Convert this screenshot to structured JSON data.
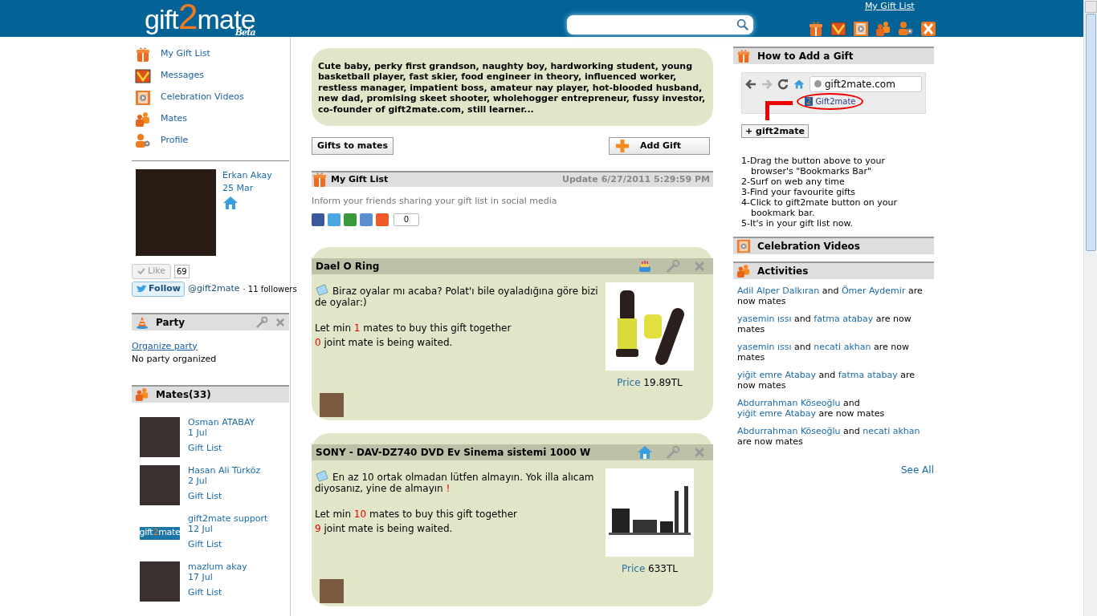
{
  "header": {
    "logo": {
      "before": "gift",
      "mark": "2",
      "after": "mate",
      "badge": "Beta"
    },
    "top_link": "My Gift List"
  },
  "nav": [
    {
      "label": "My Gift List"
    },
    {
      "label": "Messages"
    },
    {
      "label": "Celebration Videos"
    },
    {
      "label": "Mates"
    },
    {
      "label": "Profile"
    }
  ],
  "profile": {
    "name": "Erkan Akay",
    "date": "25 Mar"
  },
  "like": {
    "label": "Like",
    "count": "69"
  },
  "follow": {
    "label": "Follow",
    "handle": "@gift2mate",
    "followers": "· 11 followers"
  },
  "party": {
    "title": "Party",
    "link": "Organize party",
    "status": "No party organized"
  },
  "mates": {
    "title": "Mates(33)",
    "items": [
      {
        "name": "Osman ATABAY",
        "date": "1 Jul",
        "link": "Gift List",
        "kind": "photo"
      },
      {
        "name": "Hasan Ali Türköz",
        "date": "2 Jul",
        "link": "Gift List",
        "kind": "photo"
      },
      {
        "name": "gift2mate support",
        "date": "12 Jul",
        "link": "Gift List",
        "kind": "logo",
        "logo": {
          "before": "gift",
          "mark": "2",
          "after": "mate"
        }
      },
      {
        "name": "mazlum akay",
        "date": "17 Jul",
        "link": "Gift List",
        "kind": "photo"
      }
    ]
  },
  "bio": "Cute baby, perky first grandson, naughty boy, hardworking student, young basketball player, fast skier, food engineer in theory, influenced worker, restless manager, impatient boss, amateur nay player, hot-blooded husband, new dad, promising skeet shooter, wholehogger entrepreneur, fussy investor, co-founder of gift2mate.com, still learner...",
  "actions": [
    {
      "label": "Gifts to mates",
      "kind": "plain"
    },
    {
      "label": "Add Gift",
      "kind": "add"
    }
  ],
  "gift_list": {
    "title": "My Gift List",
    "updated": "Update 6/27/2011 5:29:59 PM",
    "share_text": "Inform your friends sharing your gift list in social media",
    "share_count": "0"
  },
  "gifts": [
    {
      "title": "Dael O Ring",
      "note": "Biraz oyalar mı acaba? Polat'ı bile oyaladığına göre bizi de oyalar:)",
      "min_prefix": "Let min",
      "min_count": "1",
      "min_suffix": "mates to buy this gift together",
      "waiting_count": "0",
      "waiting_suffix": "joint mate is being waited.",
      "price_label": "Price",
      "price": "19.89TL"
    },
    {
      "title": "SONY - DAV-DZ740 DVD Ev Sinema sistemi 1000 W",
      "note": "En az 10 ortak olmadan lütfen almayın. Yok illa alıcam diyosanız, yine de almayın",
      "note_alert": "!",
      "min_prefix": "Let min",
      "min_count": "10",
      "min_suffix": "mates to buy this gift together",
      "waiting_count": "9",
      "waiting_suffix": "joint mate is being waited.",
      "price_label": "Price",
      "price": "633TL"
    }
  ],
  "howto": {
    "title": "How to Add a Gift",
    "url": "gift2mate.com",
    "bookmark_mark": "2",
    "bookmark": "Gift2mate",
    "button": "+ gift2mate",
    "steps": [
      "1-Drag the button above to your browser's \"Bookmarks Bar\"",
      "2-Surf on web any time",
      "3-Find your favourite gifts",
      "4-Click to gift2mate button on your bookmark bar.",
      "5-It's in your gift list now."
    ]
  },
  "celebration": {
    "title": "Celebration Videos"
  },
  "activities": {
    "title": "Activities",
    "see_all": "See All",
    "items": [
      {
        "user1": "Adil Alper Dalkıran",
        "joiner": "and",
        "user2": "Ömer Aydemir",
        "rest": "are now mates"
      },
      {
        "user1": "yasemin ıssı",
        "joiner": "and",
        "user2": "fatma atabay",
        "rest": "are now mates"
      },
      {
        "user1": "yasemin ıssı",
        "joiner": "and",
        "user2": "necati akhan",
        "rest": "are now mates"
      },
      {
        "user1": "yiğit emre Atabay",
        "joiner": "and",
        "user2": "fatma atabay",
        "rest": "are now mates"
      },
      {
        "user1": "Abdurrahman Köseoğlu",
        "joiner": "and",
        "user2": "yiğit emre Atabay",
        "rest": "are now mates"
      },
      {
        "user1": "Abdurrahman Köseoğlu",
        "joiner": "and",
        "user2": "necati akhan",
        "rest": "are now mates"
      }
    ]
  }
}
